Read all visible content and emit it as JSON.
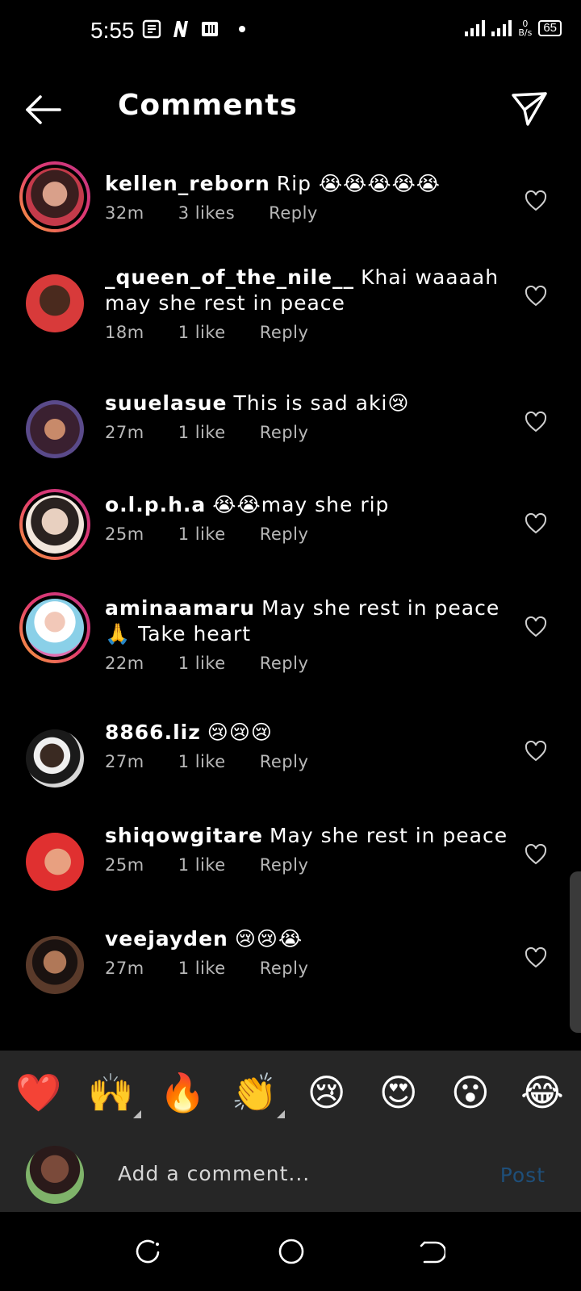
{
  "status_bar": {
    "time": "5:55",
    "net_speed_value": "0",
    "net_speed_unit": "B/s",
    "battery": "65",
    "icons": [
      "notes-icon",
      "netflix-icon",
      "pdf-app-icon",
      "dot-indicator",
      "signal-icon",
      "signal-icon",
      "battery-icon"
    ]
  },
  "header": {
    "title": "Comments",
    "back_icon": "arrow-left-icon",
    "share_icon": "send-icon"
  },
  "comments": [
    {
      "username": "kellen_reborn",
      "text": "Rip 😭😭😭😭😭",
      "time": "32m",
      "likes": "3 likes",
      "reply": "Reply",
      "ring": true
    },
    {
      "username": "_queen_of_the_nile__",
      "text": "Khai waaaah may she rest in peace",
      "time": "18m",
      "likes": "1 like",
      "reply": "Reply",
      "ring": false
    },
    {
      "username": "suuelasue",
      "text": "This is sad aki😢",
      "time": "27m",
      "likes": "1 like",
      "reply": "Reply",
      "ring": false
    },
    {
      "username": "o.l.p.h.a",
      "text": "😭😭may she rip",
      "time": "25m",
      "likes": "1 like",
      "reply": "Reply",
      "ring": true
    },
    {
      "username": "aminaamaru",
      "text": "May she rest in peace 🙏 Take heart",
      "time": "22m",
      "likes": "1 like",
      "reply": "Reply",
      "ring": true
    },
    {
      "username": "8866.liz",
      "text": "😢😢😢",
      "time": "27m",
      "likes": "1 like",
      "reply": "Reply",
      "ring": false
    },
    {
      "username": "shiqowgitare",
      "text": "May she rest in peace",
      "time": "25m",
      "likes": "1 like",
      "reply": "Reply",
      "ring": false
    },
    {
      "username": "veejayden",
      "text": "😢😢😭",
      "time": "27m",
      "likes": "1 like",
      "reply": "Reply",
      "ring": false
    }
  ],
  "emoji_bar": [
    "❤️",
    "🙌",
    "🔥",
    "👏",
    "😢",
    "😍",
    "😮",
    "😂"
  ],
  "composer": {
    "placeholder": "Add a comment...",
    "post_label": "Post"
  },
  "nav_bar": {
    "icons": [
      "recents-icon",
      "home-icon",
      "back-icon"
    ]
  },
  "colors": {
    "background": "#000000",
    "panel": "#262626",
    "meta_text": "#b8b8b8",
    "post_disabled": "#1e4f7a",
    "story_ring": "#e33a6f"
  }
}
